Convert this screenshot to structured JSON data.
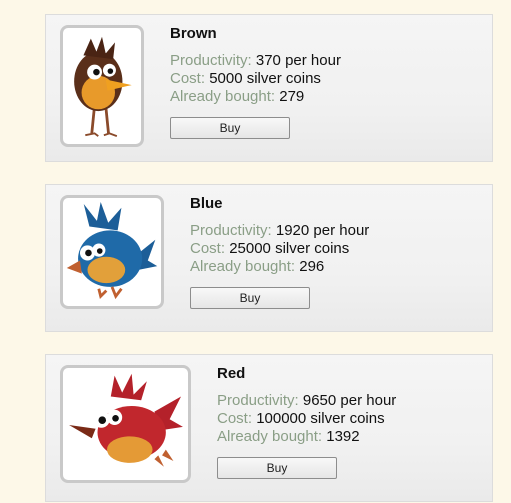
{
  "cards": [
    {
      "name": "Brown",
      "icon": "brown-bird-icon",
      "productivity_label": "Productivity:",
      "productivity": "370 per hour",
      "cost_label": "Cost:",
      "cost": "5000 silver coins",
      "bought_label": "Already bought:",
      "bought": "279",
      "buy_label": "Buy"
    },
    {
      "name": "Blue",
      "icon": "blue-bird-icon",
      "productivity_label": "Productivity:",
      "productivity": "1920 per hour",
      "cost_label": "Cost:",
      "cost": "25000 silver coins",
      "bought_label": "Already bought:",
      "bought": "296",
      "buy_label": "Buy"
    },
    {
      "name": "Red",
      "icon": "red-bird-icon",
      "productivity_label": "Productivity:",
      "productivity": "9650 per hour",
      "cost_label": "Cost:",
      "cost": "100000 silver coins",
      "bought_label": "Already bought:",
      "bought": "1392",
      "buy_label": "Buy"
    }
  ],
  "colors": {
    "background": "#fdf8e8",
    "label": "#8a9e86",
    "brown_bird": "#6b3a22",
    "blue_bird": "#1f6aa8",
    "red_bird": "#c1272d"
  }
}
